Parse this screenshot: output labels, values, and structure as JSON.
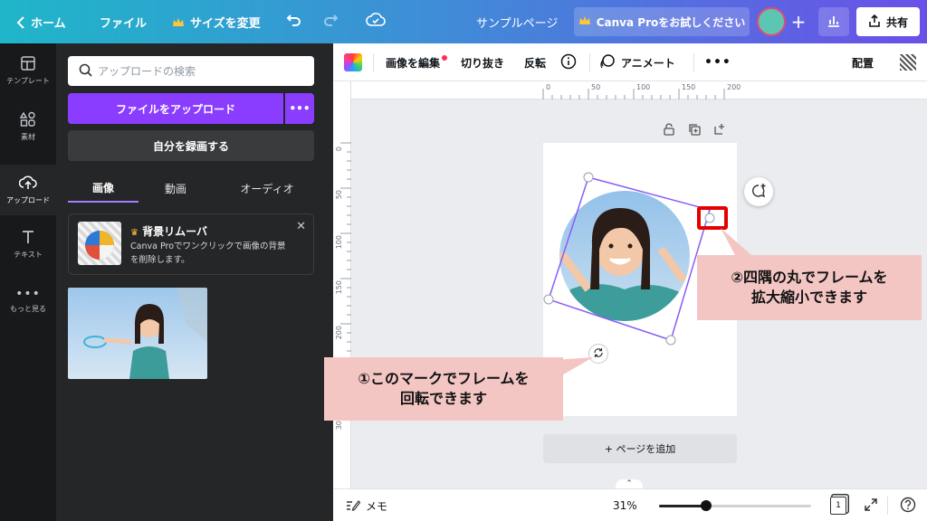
{
  "topbar": {
    "home": "ホーム",
    "file": "ファイル",
    "resize": "サイズを変更",
    "doc_title": "サンプルページ",
    "pro_cta": "Canva Proをお試しください",
    "share": "共有"
  },
  "rail": {
    "items": [
      {
        "label": "テンプレート",
        "icon": "template-icon"
      },
      {
        "label": "素材",
        "icon": "elements-icon"
      },
      {
        "label": "アップロード",
        "icon": "upload-cloud-icon"
      },
      {
        "label": "テキスト",
        "icon": "text-icon"
      },
      {
        "label": "もっと見る",
        "icon": "more-dots-icon"
      }
    ]
  },
  "panel": {
    "search_placeholder": "アップロードの検索",
    "upload_button": "ファイルをアップロード",
    "record_button": "自分を録画する",
    "tabs": [
      "画像",
      "動画",
      "オーディオ"
    ],
    "active_tab": 0,
    "promo_title": "背景リムーバ",
    "promo_desc": "Canva Proでワンクリックで画像の背景を削除します。"
  },
  "toolbar": {
    "edit_image": "画像を編集",
    "crop": "切り抜き",
    "flip": "反転",
    "animate": "アニメート",
    "position": "配置"
  },
  "ruler": {
    "h_ticks": [
      "0",
      "50",
      "100",
      "150",
      "200"
    ],
    "v_ticks": [
      "0",
      "50",
      "100",
      "150",
      "200",
      "250",
      "300"
    ]
  },
  "canvas": {
    "add_page": "+ ページを追加"
  },
  "callouts": {
    "resize_note_line1": "②四隅の丸でフレームを",
    "resize_note_line2": "拡大縮小できます",
    "rotate_note_line1": "①このマークでフレームを",
    "rotate_note_line2": "回転できます"
  },
  "bottombar": {
    "notes": "メモ",
    "zoom": "31%",
    "zoom_level": 0.31,
    "page_count": "1"
  },
  "colors": {
    "accent": "#8b3dff",
    "callout_bg": "#f3c6c4",
    "highlight": "#e50000"
  }
}
